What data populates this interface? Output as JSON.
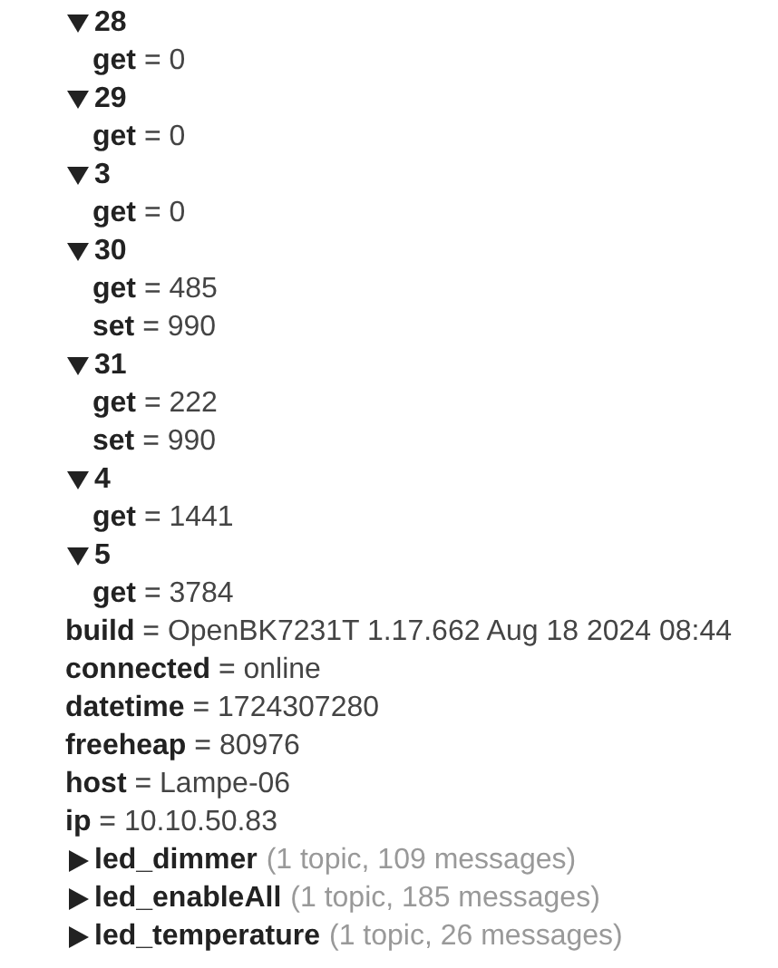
{
  "tree": [
    {
      "kind": "topic",
      "name": "28",
      "expanded": true,
      "children": [
        {
          "kind": "value",
          "text": "**get** = 0"
        }
      ]
    },
    {
      "kind": "topic",
      "name": "29",
      "expanded": true,
      "children": [
        {
          "kind": "value",
          "text": "**get** = 0"
        }
      ]
    },
    {
      "kind": "topic",
      "name": "3",
      "expanded": true,
      "children": [
        {
          "kind": "value",
          "text": "**get** = 0"
        }
      ]
    },
    {
      "kind": "topic",
      "name": "30",
      "expanded": true,
      "children": [
        {
          "kind": "value",
          "text": "**get** = 485"
        },
        {
          "kind": "value",
          "text": "**set** = 990"
        }
      ]
    },
    {
      "kind": "topic",
      "name": "31",
      "expanded": true,
      "children": [
        {
          "kind": "value",
          "text": "**get** = 222"
        },
        {
          "kind": "value",
          "text": "**set** = 990"
        }
      ]
    },
    {
      "kind": "topic",
      "name": "4",
      "expanded": true,
      "children": [
        {
          "kind": "value",
          "text": "**get** = 1441"
        }
      ]
    },
    {
      "kind": "topic",
      "name": "5",
      "expanded": true,
      "children": [
        {
          "kind": "value",
          "text": "**get** = 3784"
        }
      ]
    },
    {
      "kind": "value",
      "text": "**build** = OpenBK7231T 1.17.662 Aug 18 2024 08:44"
    },
    {
      "kind": "value",
      "text": "**connected** = online"
    },
    {
      "kind": "value",
      "text": "**datetime** = 1724307280"
    },
    {
      "kind": "value",
      "text": "**freeheap** = 80976"
    },
    {
      "kind": "value",
      "text": "**host** = Lampe-06"
    },
    {
      "kind": "value",
      "text": "**ip** = 10.10.50.83"
    },
    {
      "kind": "topic",
      "name": "led_dimmer",
      "expanded": false,
      "summary": "(1 topic, 109 messages)"
    },
    {
      "kind": "topic",
      "name": "led_enableAll",
      "expanded": false,
      "summary": "(1 topic, 185 messages)"
    },
    {
      "kind": "topic",
      "name": "led_temperature",
      "expanded": false,
      "summary": "(1 topic, 26 messages)"
    }
  ]
}
